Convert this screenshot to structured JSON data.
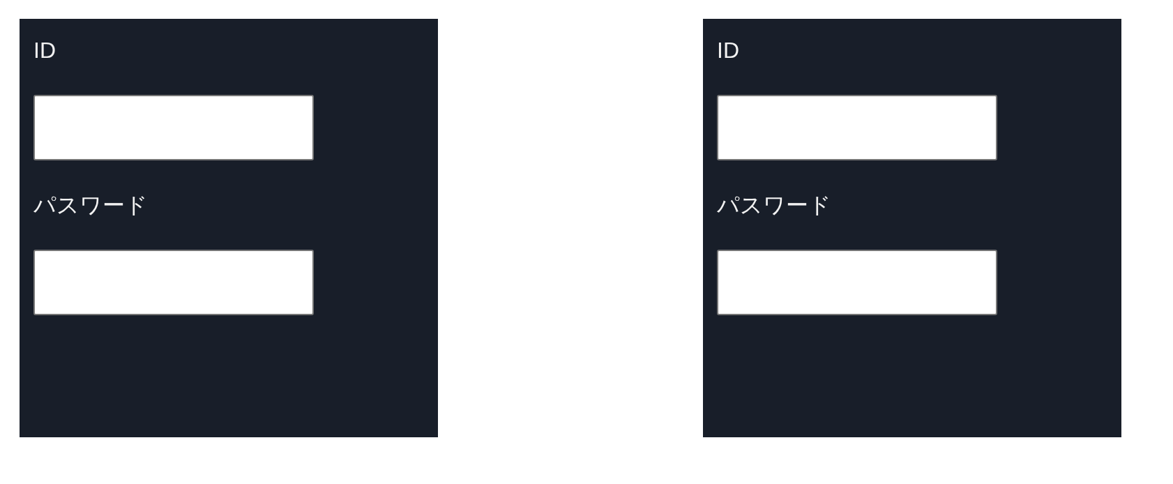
{
  "forms": [
    {
      "fields": [
        {
          "label": "ID"
        },
        {
          "label": "パスワード"
        }
      ]
    },
    {
      "fields": [
        {
          "label": "ID"
        },
        {
          "label": "パスワード"
        }
      ]
    }
  ]
}
